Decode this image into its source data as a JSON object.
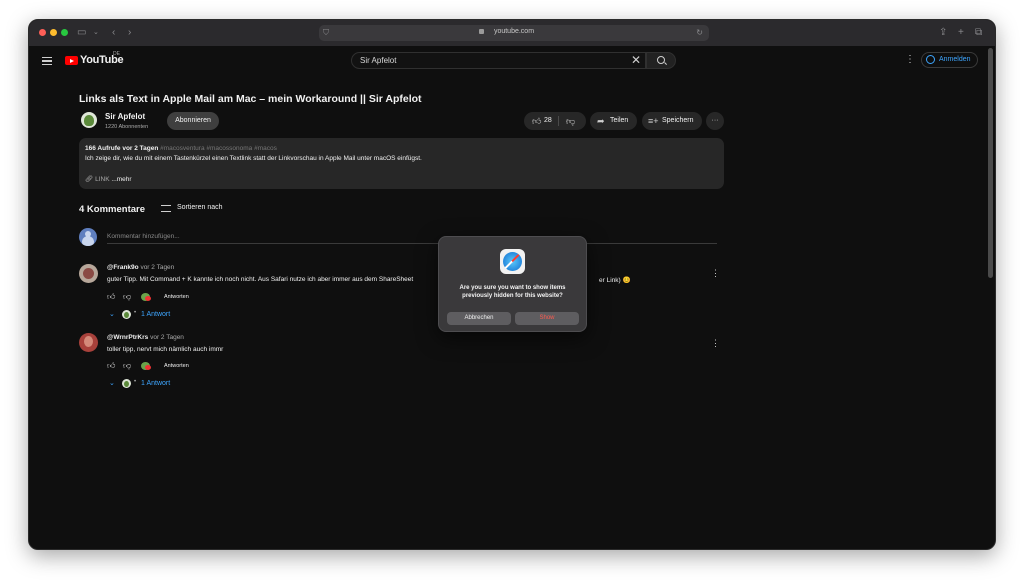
{
  "browser": {
    "url": "youtube.com"
  },
  "header": {
    "logo_text": "YouTube",
    "country_code": "DE",
    "search_value": "Sir Apfelot",
    "signin_label": "Anmelden"
  },
  "video": {
    "title": "Links als Text in Apple Mail am Mac – mein Workaround || Sir Apfelot",
    "channel_name": "Sir Apfelot",
    "subscribers": "1220 Abonnenten",
    "subscribe_label": "Abonnieren",
    "likes": "28",
    "share_label": "Teilen",
    "save_label": "Speichern"
  },
  "description": {
    "meta": "166 Aufrufe  vor 2 Tagen",
    "tags": "#macosventura #macossonoma #macos",
    "text": "Ich zeige dir, wie du mit einem Tastenkürzel einen Textlink statt der Linkvorschau in Apple Mail unter macOS einfügst.",
    "link": "LINK",
    "more": "...mehr"
  },
  "comments": {
    "count_label": "4 Kommentare",
    "sort_label": "Sortieren nach",
    "input_placeholder": "Kommentar hinzufügen...",
    "items": [
      {
        "author": "@Frank9o",
        "time": "vor 2 Tagen",
        "text": "guter Tipp. Mit Command + K kannte ich noch nicht. Aus Safari nutze ich aber immer aus dem ShareSheet",
        "text_tail": "er Link) 😊",
        "reply_label": "Antworten",
        "replies_label": "1 Antwort"
      },
      {
        "author": "@WrnrPtrKrs",
        "time": "vor 2 Tagen",
        "text": "toller tipp, nervt mich nämlich auch immr",
        "reply_label": "Antworten",
        "replies_label": "1 Antwort"
      }
    ]
  },
  "dialog": {
    "message": "Are you sure you want to show items previously hidden for this website?",
    "cancel_label": "Abbrechen",
    "confirm_label": "Show"
  },
  "icons": [
    "search-icon",
    "close-icon",
    "user-icon",
    "thumb-up-icon",
    "thumb-down-icon",
    "share-icon",
    "save-icon",
    "more-icon",
    "sort-icon",
    "safari-icon",
    "lock-icon"
  ],
  "colors": {
    "accent_blue": "#3ea6ff",
    "youtube_red": "#ff0000",
    "destructive": "#ff5a4f"
  }
}
